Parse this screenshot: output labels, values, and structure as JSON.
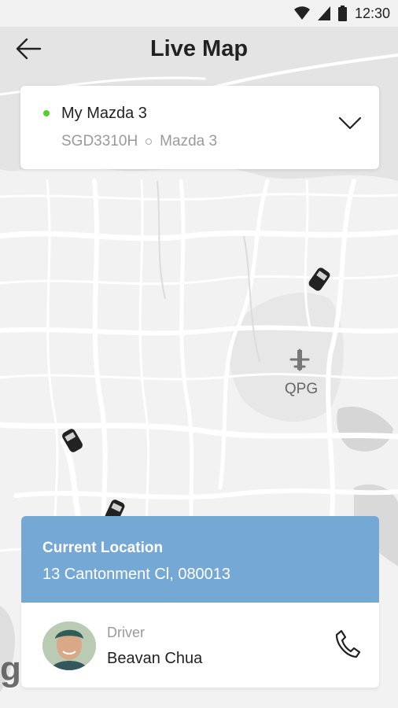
{
  "status_bar": {
    "time": "12:30",
    "icons": [
      "wifi-icon",
      "signal-icon",
      "battery-icon"
    ]
  },
  "app_bar": {
    "title": "Live Map",
    "back_icon": "back-arrow-icon"
  },
  "vehicle": {
    "name": "My Mazda 3",
    "plate": "SGD3310H",
    "model": "Mazda 3",
    "status_color": "#55cc33",
    "expand_icon": "chevron-down-icon"
  },
  "map": {
    "airport_code": "QPG",
    "airport_icon": "plane-icon",
    "car_markers": 3,
    "watermark": "g"
  },
  "current_location": {
    "label": "Current Location",
    "address": "13 Cantonment Cl, 080013",
    "accent": "#76a8d5"
  },
  "driver": {
    "label": "Driver",
    "name": "Beavan Chua",
    "call_icon": "phone-icon"
  }
}
